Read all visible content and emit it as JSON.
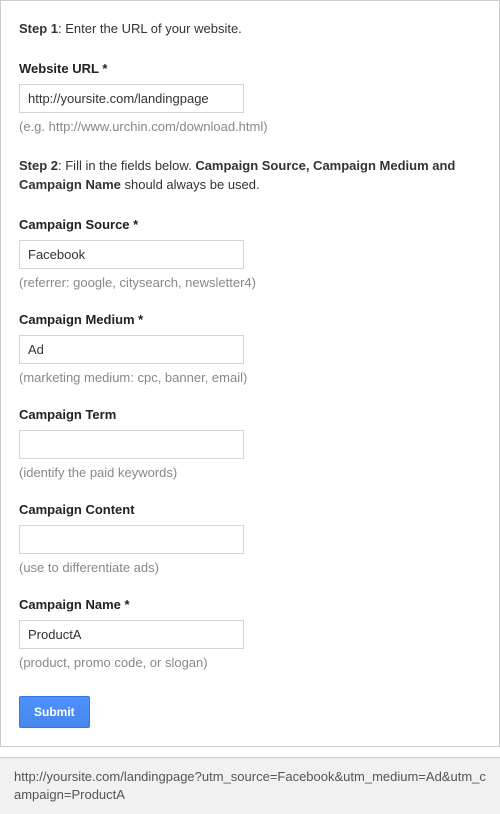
{
  "step1": {
    "label": "Step 1",
    "text": ": Enter the URL of your website."
  },
  "website_url": {
    "label": "Website URL *",
    "value": "http://yoursite.com/landingpage",
    "hint": "(e.g. http://www.urchin.com/download.html)"
  },
  "step2": {
    "label": "Step 2",
    "text_before": ": Fill in the fields below. ",
    "bold_part": "Campaign Source, Campaign Medium and Campaign Name",
    "text_after": " should always be used."
  },
  "campaign_source": {
    "label": "Campaign Source *",
    "value": "Facebook",
    "hint": "(referrer: google, citysearch, newsletter4)"
  },
  "campaign_medium": {
    "label": "Campaign Medium *",
    "value": "Ad",
    "hint": "(marketing medium: cpc, banner, email)"
  },
  "campaign_term": {
    "label": "Campaign Term",
    "value": "",
    "hint": "(identify the paid keywords)"
  },
  "campaign_content": {
    "label": "Campaign Content",
    "value": "",
    "hint": "(use to differentiate ads)"
  },
  "campaign_name": {
    "label": "Campaign Name *",
    "value": "ProductA",
    "hint": "(product, promo code, or slogan)"
  },
  "submit_label": "Submit",
  "result_url": "http://yoursite.com/landingpage?utm_source=Facebook&utm_medium=Ad&utm_campaign=ProductA"
}
